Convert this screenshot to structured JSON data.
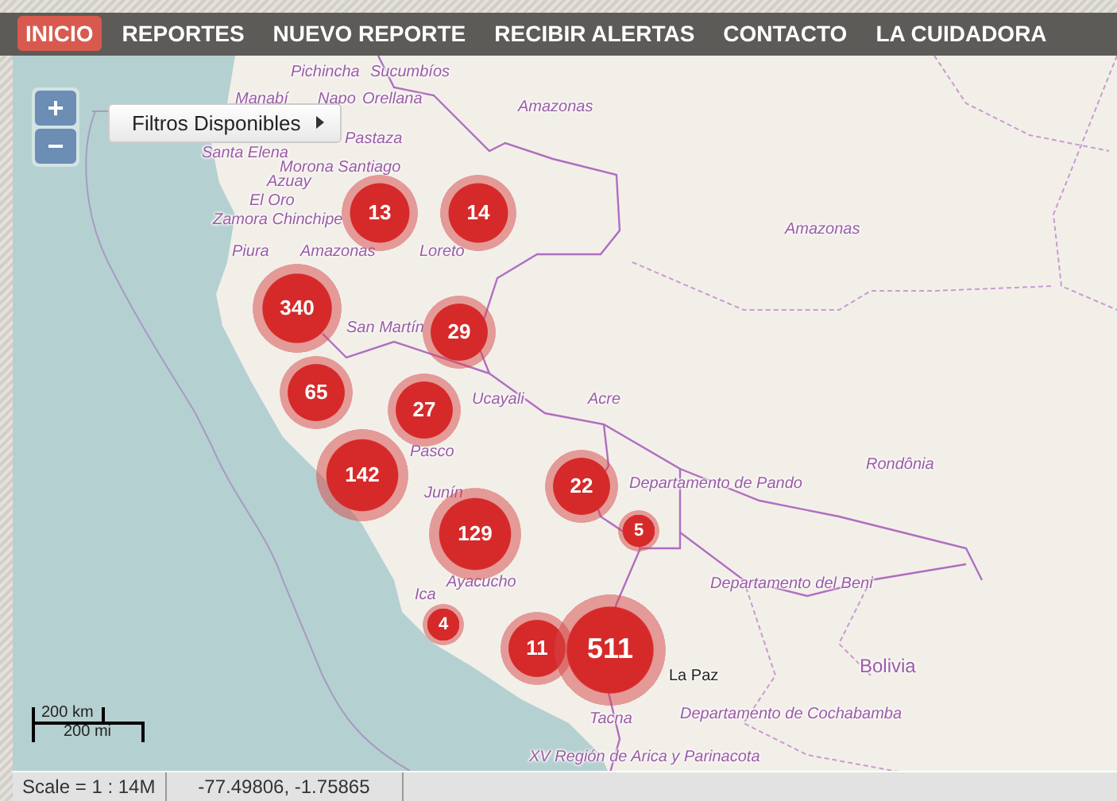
{
  "nav": [
    {
      "label": "INICIO",
      "selected": true
    },
    {
      "label": "REPORTES",
      "selected": false
    },
    {
      "label": "NUEVO REPORTE",
      "selected": false
    },
    {
      "label": "RECIBIR ALERTAS",
      "selected": false
    },
    {
      "label": "CONTACTO",
      "selected": false
    },
    {
      "label": "LA CUIDADORA",
      "selected": false
    }
  ],
  "map": {
    "zoom_in": "+",
    "zoom_out": "−",
    "filter_button": {
      "label": "Filtros Disponibles"
    },
    "labels": [
      {
        "text": "Pichincha",
        "kind": "region"
      },
      {
        "text": "Sucumbíos",
        "kind": "region"
      },
      {
        "text": "Manabí",
        "kind": "region"
      },
      {
        "text": "Napo",
        "kind": "region"
      },
      {
        "text": "Orellana",
        "kind": "region"
      },
      {
        "text": "Amazonas",
        "kind": "region"
      },
      {
        "text": "Pastaza",
        "kind": "region"
      },
      {
        "text": "Santa Elena",
        "kind": "region"
      },
      {
        "text": "Morona Santiago",
        "kind": "region"
      },
      {
        "text": "Azuay",
        "kind": "region"
      },
      {
        "text": "El Oro",
        "kind": "region"
      },
      {
        "text": "Zamora Chinchipe",
        "kind": "region"
      },
      {
        "text": "Piura",
        "kind": "region"
      },
      {
        "text": "Amazonas",
        "kind": "region"
      },
      {
        "text": "Loreto",
        "kind": "region"
      },
      {
        "text": "Amazonas",
        "kind": "region"
      },
      {
        "text": "San Martín",
        "kind": "region"
      },
      {
        "text": "Ucayali",
        "kind": "region"
      },
      {
        "text": "Acre",
        "kind": "region"
      },
      {
        "text": "Rondônia",
        "kind": "region"
      },
      {
        "text": "Pasco",
        "kind": "region"
      },
      {
        "text": "Junín",
        "kind": "region"
      },
      {
        "text": "Departamento de Pando",
        "kind": "region"
      },
      {
        "text": "Ayacucho",
        "kind": "region"
      },
      {
        "text": "Ica",
        "kind": "region"
      },
      {
        "text": "Departamento del Beni",
        "kind": "region"
      },
      {
        "text": "Bolivia",
        "kind": "country"
      },
      {
        "text": "La Paz",
        "kind": "city"
      },
      {
        "text": "Tacna",
        "kind": "region"
      },
      {
        "text": "Departamento de Cochabamba",
        "kind": "region"
      },
      {
        "text": "XV Región de Arica y Parinacota",
        "kind": "region"
      }
    ],
    "clusters": [
      {
        "count": "13"
      },
      {
        "count": "14"
      },
      {
        "count": "340"
      },
      {
        "count": "29"
      },
      {
        "count": "65"
      },
      {
        "count": "27"
      },
      {
        "count": "142"
      },
      {
        "count": "22"
      },
      {
        "count": "5"
      },
      {
        "count": "129"
      },
      {
        "count": "4"
      },
      {
        "count": "11"
      },
      {
        "count": "511"
      }
    ],
    "scale_bar": {
      "km": "200 km",
      "mi": "200 mi"
    }
  },
  "status_bar": {
    "scale": "Scale = 1 : 14M",
    "coordinates": "-77.49806, -1.75865"
  }
}
